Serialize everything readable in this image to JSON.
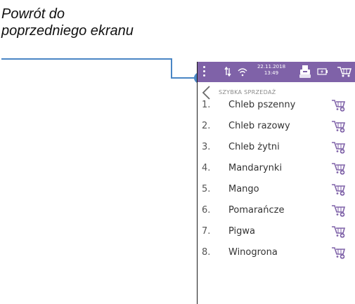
{
  "annotation": {
    "line1": "Powrót do",
    "line2": "poprzedniego ekranu"
  },
  "colors": {
    "statusbar": "#7f62a8",
    "accent": "#7f62a8",
    "callout_line": "#4a86c5"
  },
  "statusbar": {
    "date": "22.11.2018",
    "time": "13:49",
    "icons": [
      "menu-dots-icon",
      "data-transfer-icon",
      "wifi-icon",
      "printer-cash-icon",
      "battery-icon",
      "cart-icon"
    ]
  },
  "screen": {
    "title": "SZYBKA SPRZEDAŻ",
    "back_icon": "chevron-left-icon"
  },
  "products": [
    {
      "num": "1.",
      "name": "Chleb pszenny"
    },
    {
      "num": "2.",
      "name": "Chleb razowy"
    },
    {
      "num": "3.",
      "name": "Chleb żytni"
    },
    {
      "num": "4.",
      "name": "Mandarynki"
    },
    {
      "num": "5.",
      "name": "Mango"
    },
    {
      "num": "6.",
      "name": "Pomarańcze"
    },
    {
      "num": "7.",
      "name": "Pigwa"
    },
    {
      "num": "8.",
      "name": "Winogrona"
    }
  ]
}
